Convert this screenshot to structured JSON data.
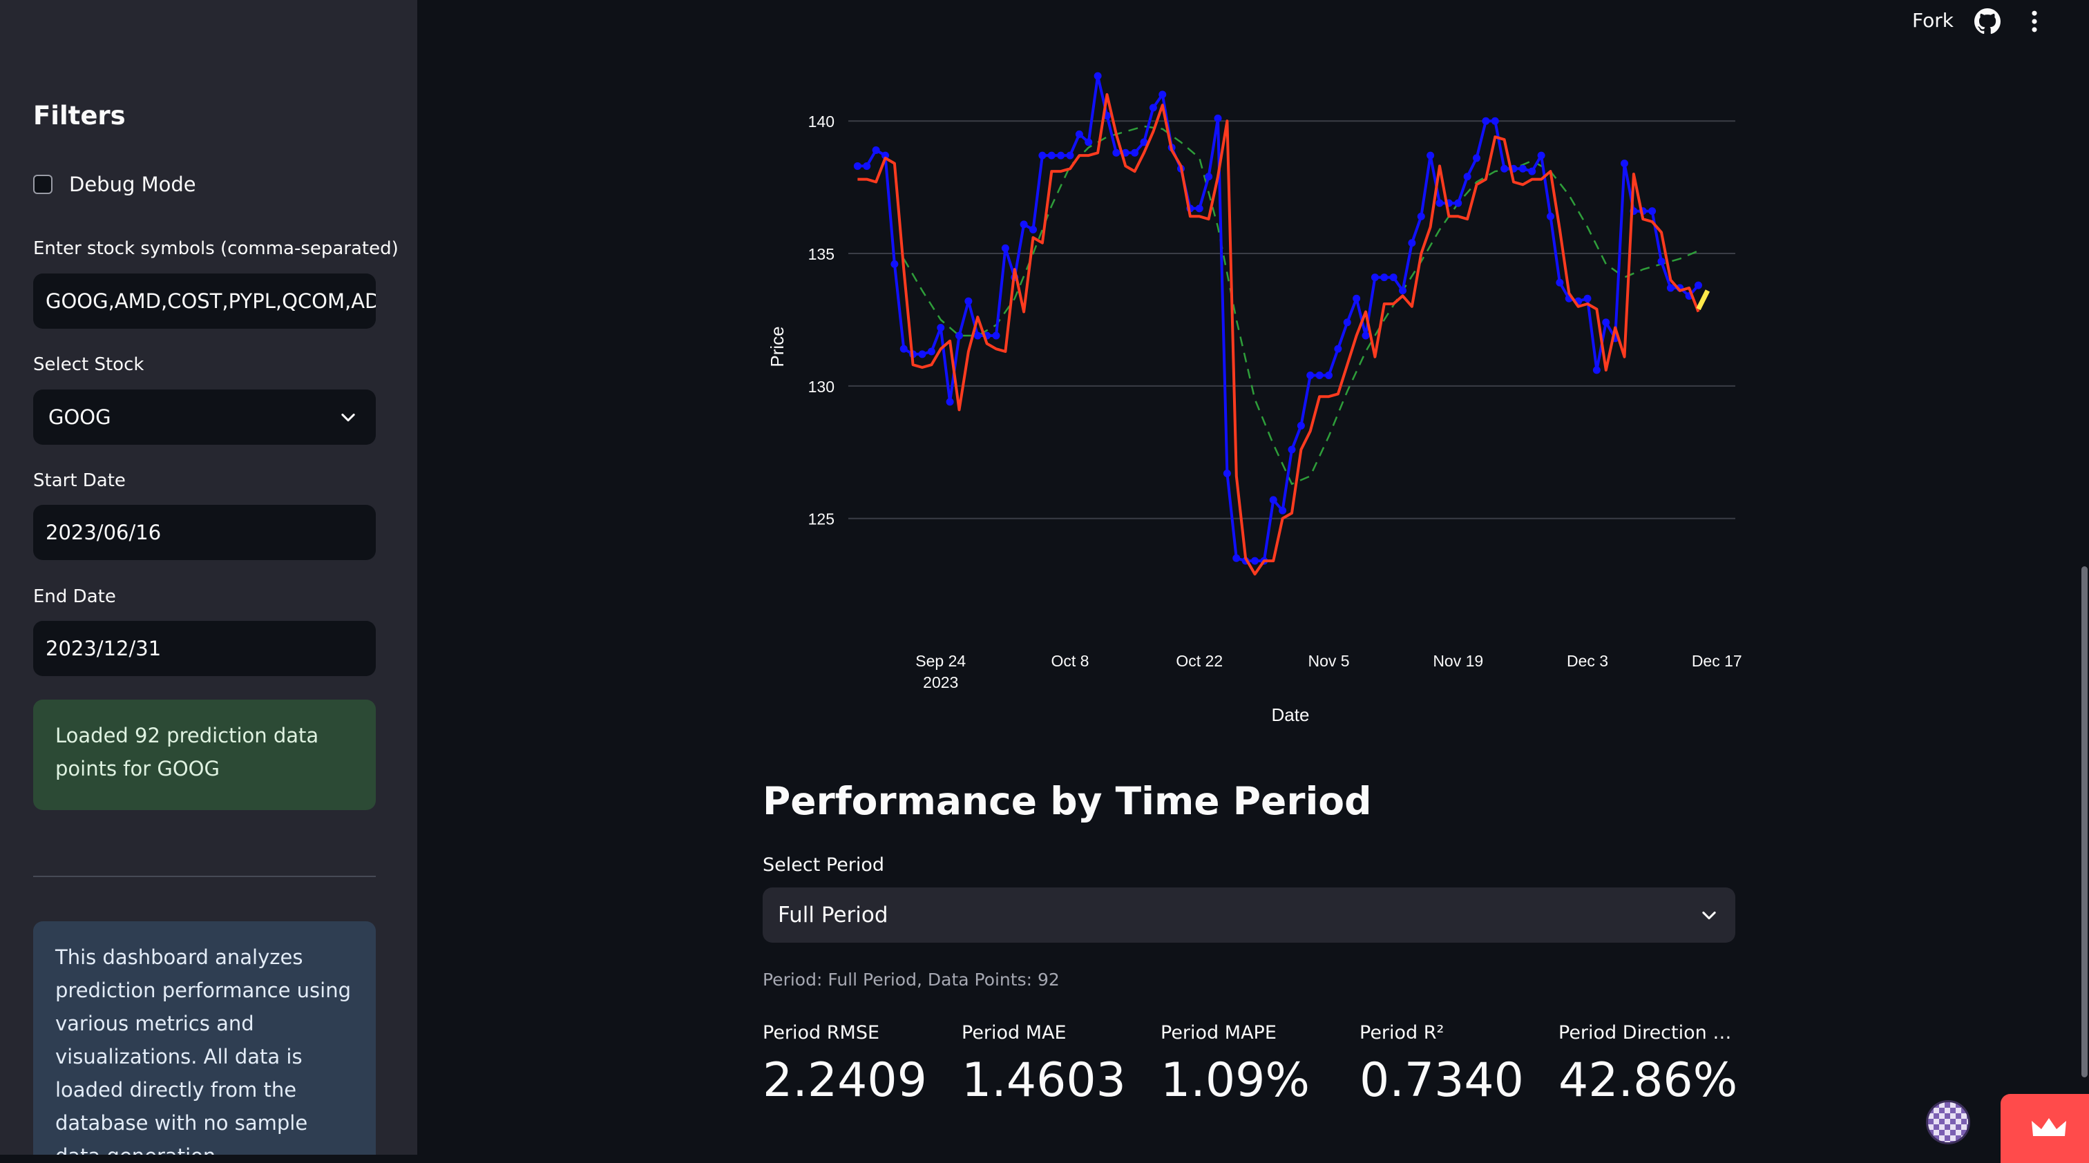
{
  "header": {
    "fork_label": "Fork"
  },
  "sidebar": {
    "title": "Filters",
    "debug_mode": {
      "label": "Debug Mode",
      "checked": false
    },
    "symbols": {
      "label": "Enter stock symbols (comma-separated)",
      "value": "GOOG,AMD,COST,PYPL,QCOM,ADBE"
    },
    "stock_select": {
      "label": "Select Stock",
      "value": "GOOG"
    },
    "start_date": {
      "label": "Start Date",
      "value": "2023/06/16"
    },
    "end_date": {
      "label": "End Date",
      "value": "2023/12/31"
    },
    "success_message": "Loaded 92 prediction data points for GOOG",
    "info_message": "This dashboard analyzes prediction performance using various metrics and visualizations. All data is loaded directly from the database with no sample data generation."
  },
  "chart_data": {
    "type": "line",
    "xlabel": "Date",
    "ylabel": "Price",
    "ylim": [
      121.5,
      141.7
    ],
    "yticks": [
      125,
      130,
      135,
      140
    ],
    "xticks": [
      {
        "date": "2023-09-24",
        "label": "Sep 24",
        "sublabel": "2023"
      },
      {
        "date": "2023-10-08",
        "label": "Oct 8",
        "sublabel": ""
      },
      {
        "date": "2023-10-22",
        "label": "Oct 22",
        "sublabel": ""
      },
      {
        "date": "2023-11-05",
        "label": "Nov 5",
        "sublabel": ""
      },
      {
        "date": "2023-11-19",
        "label": "Nov 19",
        "sublabel": ""
      },
      {
        "date": "2023-12-03",
        "label": "Dec 3",
        "sublabel": ""
      },
      {
        "date": "2023-12-17",
        "label": "Dec 17",
        "sublabel": ""
      }
    ],
    "xlim": [
      "2023-09-14",
      "2023-12-19"
    ],
    "grid": true,
    "colors": {
      "actual": "#1010ff",
      "predicted": "#ff3b1f",
      "moving_average": "#2e9e3a",
      "forecast": "#ffe94a",
      "grid": "#3a3d46"
    },
    "series": [
      {
        "key": "actual",
        "style": "markers",
        "values": [
          [
            "2023-09-15",
            138.3
          ],
          [
            "2023-09-16",
            138.3
          ],
          [
            "2023-09-17",
            138.9
          ],
          [
            "2023-09-18",
            138.7
          ],
          [
            "2023-09-19",
            134.6
          ],
          [
            "2023-09-20",
            131.4
          ],
          [
            "2023-09-21",
            131.2
          ],
          [
            "2023-09-22",
            131.2
          ],
          [
            "2023-09-23",
            131.3
          ],
          [
            "2023-09-24",
            132.2
          ],
          [
            "2023-09-25",
            129.4
          ],
          [
            "2023-09-26",
            131.9
          ],
          [
            "2023-09-27",
            133.2
          ],
          [
            "2023-09-28",
            131.9
          ],
          [
            "2023-09-29",
            131.9
          ],
          [
            "2023-09-30",
            131.9
          ],
          [
            "2023-10-01",
            135.2
          ],
          [
            "2023-10-02",
            134.1
          ],
          [
            "2023-10-03",
            136.1
          ],
          [
            "2023-10-04",
            135.9
          ],
          [
            "2023-10-05",
            138.7
          ],
          [
            "2023-10-06",
            138.7
          ],
          [
            "2023-10-07",
            138.7
          ],
          [
            "2023-10-08",
            138.7
          ],
          [
            "2023-10-09",
            139.5
          ],
          [
            "2023-10-10",
            139.2
          ],
          [
            "2023-10-11",
            141.7
          ],
          [
            "2023-10-12",
            140.2
          ],
          [
            "2023-10-13",
            138.8
          ],
          [
            "2023-10-14",
            138.8
          ],
          [
            "2023-10-15",
            138.8
          ],
          [
            "2023-10-16",
            139.2
          ],
          [
            "2023-10-17",
            140.5
          ],
          [
            "2023-10-18",
            141.0
          ],
          [
            "2023-10-19",
            139.0
          ],
          [
            "2023-10-20",
            138.2
          ],
          [
            "2023-10-21",
            136.7
          ],
          [
            "2023-10-22",
            136.7
          ],
          [
            "2023-10-23",
            137.9
          ],
          [
            "2023-10-24",
            140.1
          ],
          [
            "2023-10-25",
            126.7
          ],
          [
            "2023-10-26",
            123.5
          ],
          [
            "2023-10-27",
            123.4
          ],
          [
            "2023-10-28",
            123.4
          ],
          [
            "2023-10-29",
            123.4
          ],
          [
            "2023-10-30",
            125.7
          ],
          [
            "2023-10-31",
            125.3
          ],
          [
            "2023-11-01",
            127.6
          ],
          [
            "2023-11-02",
            128.5
          ],
          [
            "2023-11-03",
            130.4
          ],
          [
            "2023-11-04",
            130.4
          ],
          [
            "2023-11-05",
            130.4
          ],
          [
            "2023-11-06",
            131.4
          ],
          [
            "2023-11-07",
            132.4
          ],
          [
            "2023-11-08",
            133.3
          ],
          [
            "2023-11-09",
            131.9
          ],
          [
            "2023-11-10",
            134.1
          ],
          [
            "2023-11-11",
            134.1
          ],
          [
            "2023-11-12",
            134.1
          ],
          [
            "2023-11-13",
            133.6
          ],
          [
            "2023-11-14",
            135.4
          ],
          [
            "2023-11-15",
            136.4
          ],
          [
            "2023-11-16",
            138.7
          ],
          [
            "2023-11-17",
            136.9
          ],
          [
            "2023-11-18",
            136.9
          ],
          [
            "2023-11-19",
            136.9
          ],
          [
            "2023-11-20",
            137.9
          ],
          [
            "2023-11-21",
            138.6
          ],
          [
            "2023-11-22",
            140.0
          ],
          [
            "2023-11-23",
            140.0
          ],
          [
            "2023-11-24",
            138.2
          ],
          [
            "2023-11-25",
            138.2
          ],
          [
            "2023-11-26",
            138.2
          ],
          [
            "2023-11-27",
            138.1
          ],
          [
            "2023-11-28",
            138.7
          ],
          [
            "2023-11-29",
            136.4
          ],
          [
            "2023-11-30",
            133.9
          ],
          [
            "2023-12-01",
            133.3
          ],
          [
            "2023-12-02",
            133.2
          ],
          [
            "2023-12-03",
            133.3
          ],
          [
            "2023-12-04",
            130.6
          ],
          [
            "2023-12-05",
            132.4
          ],
          [
            "2023-12-06",
            131.8
          ],
          [
            "2023-12-07",
            138.4
          ],
          [
            "2023-12-08",
            136.6
          ],
          [
            "2023-12-09",
            136.6
          ],
          [
            "2023-12-10",
            136.6
          ],
          [
            "2023-12-11",
            134.7
          ],
          [
            "2023-12-12",
            133.7
          ],
          [
            "2023-12-13",
            133.7
          ],
          [
            "2023-12-14",
            133.4
          ],
          [
            "2023-12-15",
            133.8
          ]
        ]
      },
      {
        "key": "predicted",
        "style": "line",
        "values": [
          [
            "2023-09-15",
            137.8
          ],
          [
            "2023-09-16",
            137.8
          ],
          [
            "2023-09-17",
            137.7
          ],
          [
            "2023-09-18",
            138.6
          ],
          [
            "2023-09-19",
            138.4
          ],
          [
            "2023-09-20",
            134.4
          ],
          [
            "2023-09-21",
            130.8
          ],
          [
            "2023-09-22",
            130.7
          ],
          [
            "2023-09-23",
            130.8
          ],
          [
            "2023-09-24",
            131.4
          ],
          [
            "2023-09-25",
            131.7
          ],
          [
            "2023-09-26",
            129.1
          ],
          [
            "2023-09-27",
            131.3
          ],
          [
            "2023-09-28",
            132.6
          ],
          [
            "2023-09-29",
            131.6
          ],
          [
            "2023-09-30",
            131.4
          ],
          [
            "2023-10-01",
            131.3
          ],
          [
            "2023-10-02",
            134.4
          ],
          [
            "2023-10-03",
            132.8
          ],
          [
            "2023-10-04",
            135.6
          ],
          [
            "2023-10-05",
            135.4
          ],
          [
            "2023-10-06",
            138.1
          ],
          [
            "2023-10-07",
            138.1
          ],
          [
            "2023-10-08",
            138.2
          ],
          [
            "2023-10-09",
            138.7
          ],
          [
            "2023-10-10",
            138.7
          ],
          [
            "2023-10-11",
            138.8
          ],
          [
            "2023-10-12",
            141.0
          ],
          [
            "2023-10-13",
            139.5
          ],
          [
            "2023-10-14",
            138.3
          ],
          [
            "2023-10-15",
            138.1
          ],
          [
            "2023-10-16",
            138.8
          ],
          [
            "2023-10-17",
            139.6
          ],
          [
            "2023-10-18",
            140.6
          ],
          [
            "2023-10-19",
            138.9
          ],
          [
            "2023-10-20",
            138.3
          ],
          [
            "2023-10-21",
            136.4
          ],
          [
            "2023-10-22",
            136.4
          ],
          [
            "2023-10-23",
            136.3
          ],
          [
            "2023-10-24",
            137.9
          ],
          [
            "2023-10-25",
            140.0
          ],
          [
            "2023-10-26",
            126.6
          ],
          [
            "2023-10-27",
            123.5
          ],
          [
            "2023-10-28",
            122.9
          ],
          [
            "2023-10-29",
            123.4
          ],
          [
            "2023-10-30",
            123.4
          ],
          [
            "2023-10-31",
            125.0
          ],
          [
            "2023-11-01",
            125.2
          ],
          [
            "2023-11-02",
            127.6
          ],
          [
            "2023-11-03",
            128.3
          ],
          [
            "2023-11-04",
            129.6
          ],
          [
            "2023-11-05",
            129.6
          ],
          [
            "2023-11-06",
            129.7
          ],
          [
            "2023-11-07",
            130.8
          ],
          [
            "2023-11-08",
            131.9
          ],
          [
            "2023-11-09",
            132.8
          ],
          [
            "2023-11-10",
            131.1
          ],
          [
            "2023-11-11",
            133.1
          ],
          [
            "2023-11-12",
            133.1
          ],
          [
            "2023-11-13",
            133.4
          ],
          [
            "2023-11-14",
            133.0
          ],
          [
            "2023-11-15",
            135.0
          ],
          [
            "2023-11-16",
            136.0
          ],
          [
            "2023-11-17",
            138.3
          ],
          [
            "2023-11-18",
            136.4
          ],
          [
            "2023-11-19",
            136.4
          ],
          [
            "2023-11-20",
            136.3
          ],
          [
            "2023-11-21",
            137.6
          ],
          [
            "2023-11-22",
            137.8
          ],
          [
            "2023-11-23",
            139.4
          ],
          [
            "2023-11-24",
            139.3
          ],
          [
            "2023-11-25",
            137.7
          ],
          [
            "2023-11-26",
            137.6
          ],
          [
            "2023-11-27",
            137.8
          ],
          [
            "2023-11-28",
            137.8
          ],
          [
            "2023-11-29",
            138.1
          ],
          [
            "2023-11-30",
            135.9
          ],
          [
            "2023-12-01",
            133.5
          ],
          [
            "2023-12-02",
            133.0
          ],
          [
            "2023-12-03",
            133.1
          ],
          [
            "2023-12-04",
            132.9
          ],
          [
            "2023-12-05",
            130.6
          ],
          [
            "2023-12-06",
            132.2
          ],
          [
            "2023-12-07",
            131.1
          ],
          [
            "2023-12-08",
            138.0
          ],
          [
            "2023-12-09",
            136.3
          ],
          [
            "2023-12-10",
            136.2
          ],
          [
            "2023-12-11",
            135.8
          ],
          [
            "2023-12-12",
            134.0
          ],
          [
            "2023-12-13",
            133.6
          ],
          [
            "2023-12-14",
            133.7
          ],
          [
            "2023-12-15",
            132.8
          ]
        ]
      },
      {
        "key": "moving_average",
        "style": "dashed",
        "values": [
          [
            "2023-09-20",
            134.8
          ],
          [
            "2023-09-22",
            133.6
          ],
          [
            "2023-09-24",
            132.5
          ],
          [
            "2023-09-26",
            131.9
          ],
          [
            "2023-09-28",
            131.9
          ],
          [
            "2023-09-30",
            132.3
          ],
          [
            "2023-10-02",
            133.3
          ],
          [
            "2023-10-04",
            135.0
          ],
          [
            "2023-10-06",
            136.8
          ],
          [
            "2023-10-08",
            138.3
          ],
          [
            "2023-10-10",
            139.0
          ],
          [
            "2023-10-12",
            139.4
          ],
          [
            "2023-10-14",
            139.6
          ],
          [
            "2023-10-16",
            139.8
          ],
          [
            "2023-10-18",
            139.7
          ],
          [
            "2023-10-20",
            139.2
          ],
          [
            "2023-10-22",
            138.6
          ],
          [
            "2023-10-24",
            136.0
          ],
          [
            "2023-10-26",
            132.5
          ],
          [
            "2023-10-28",
            129.5
          ],
          [
            "2023-10-30",
            127.8
          ],
          [
            "2023-11-01",
            126.3
          ],
          [
            "2023-11-03",
            126.6
          ],
          [
            "2023-11-05",
            128.1
          ],
          [
            "2023-11-07",
            129.8
          ],
          [
            "2023-11-09",
            131.3
          ],
          [
            "2023-11-11",
            132.5
          ],
          [
            "2023-11-13",
            133.6
          ],
          [
            "2023-11-15",
            134.7
          ],
          [
            "2023-11-17",
            135.9
          ],
          [
            "2023-11-19",
            136.9
          ],
          [
            "2023-11-21",
            137.7
          ],
          [
            "2023-11-23",
            138.1
          ],
          [
            "2023-11-25",
            138.2
          ],
          [
            "2023-11-27",
            138.5
          ],
          [
            "2023-11-29",
            138.1
          ],
          [
            "2023-12-01",
            137.2
          ],
          [
            "2023-12-03",
            136.0
          ],
          [
            "2023-12-05",
            134.6
          ],
          [
            "2023-12-07",
            134.1
          ],
          [
            "2023-12-09",
            134.4
          ],
          [
            "2023-12-11",
            134.6
          ],
          [
            "2023-12-13",
            134.8
          ],
          [
            "2023-12-15",
            135.1
          ]
        ]
      },
      {
        "key": "forecast",
        "style": "line",
        "values": [
          [
            "2023-12-15",
            132.9
          ],
          [
            "2023-12-16",
            133.6
          ]
        ]
      }
    ]
  },
  "performance": {
    "title": "Performance by Time Period",
    "select_label": "Select Period",
    "period_value": "Full Period",
    "caption": "Period: Full Period, Data Points: 92",
    "metrics": [
      {
        "label": "Period RMSE",
        "value": "2.2409"
      },
      {
        "label": "Period MAE",
        "value": "1.4603"
      },
      {
        "label": "Period MAPE",
        "value": "1.09%"
      },
      {
        "label": "Period R²",
        "value": "0.7340"
      },
      {
        "label": "Period Direction Ac...",
        "value": "42.86%"
      }
    ]
  }
}
